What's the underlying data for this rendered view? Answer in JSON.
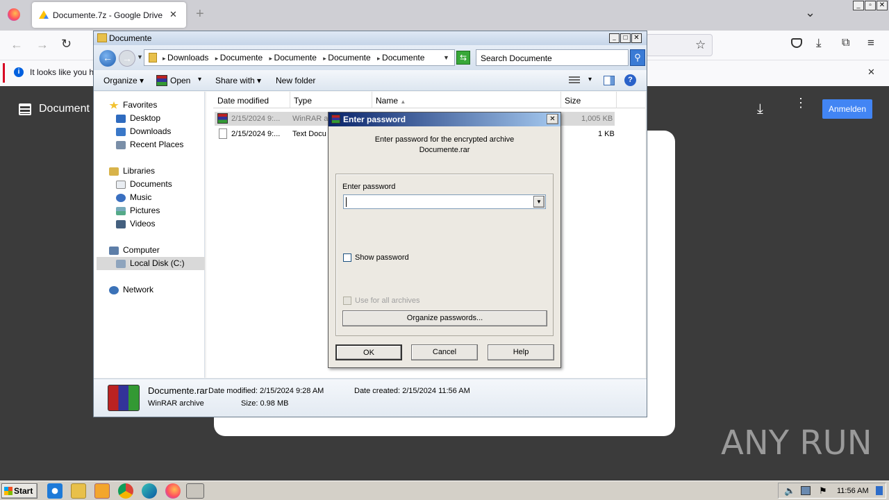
{
  "browser": {
    "tab_title": "Documente.7z - Google Drive",
    "tab_close": "✕",
    "new_tab": "+",
    "tab_list": "⌄",
    "info_text": "It looks like you ha",
    "info_close": "✕",
    "window_controls": [
      "_",
      "▫",
      "✕"
    ]
  },
  "drive": {
    "title": "Document",
    "signin_label": "Anmelden"
  },
  "explorer": {
    "title": "Documente",
    "breadcrumbs": [
      "Downloads",
      "Documente",
      "Documente",
      "Documente",
      "Documente"
    ],
    "search_placeholder": "Search Documente",
    "toolbar": {
      "organize": "Organize",
      "open": "Open",
      "share_with": "Share with",
      "new_folder": "New folder"
    },
    "sidebar": {
      "favorites": "Favorites",
      "favorites_items": [
        "Desktop",
        "Downloads",
        "Recent Places"
      ],
      "libraries": "Libraries",
      "libraries_items": [
        "Documents",
        "Music",
        "Pictures",
        "Videos"
      ],
      "computer": "Computer",
      "computer_items": [
        "Local Disk (C:)"
      ],
      "network": "Network"
    },
    "columns": {
      "date": "Date modified",
      "type": "Type",
      "name": "Name",
      "size": "Size"
    },
    "files": [
      {
        "date": "2/15/2024 9:...",
        "type": "WinRAR ar",
        "size": "1,005 KB"
      },
      {
        "date": "2/15/2024 9:...",
        "type": "Text Docu",
        "size": "1 KB"
      }
    ],
    "details": {
      "filename": "Documente.rar",
      "filetype": "WinRAR archive",
      "modified": "Date modified: 2/15/2024 9:28 AM",
      "created": "Date created: 2/15/2024 11:56 AM",
      "size": "Size: 0.98 MB"
    }
  },
  "dialog": {
    "title": "Enter password",
    "message_line1": "Enter password for the encrypted archive",
    "message_line2": "Documente.rar",
    "password_label": "Enter password",
    "password_value": "",
    "show_password": "Show password",
    "use_all": "Use for all archives",
    "organize_btn": "Organize passwords...",
    "ok": "OK",
    "cancel": "Cancel",
    "help": "Help",
    "close": "✕"
  },
  "taskbar": {
    "start": "Start",
    "clock": "11:56 AM"
  },
  "watermark": "ANY RUN"
}
